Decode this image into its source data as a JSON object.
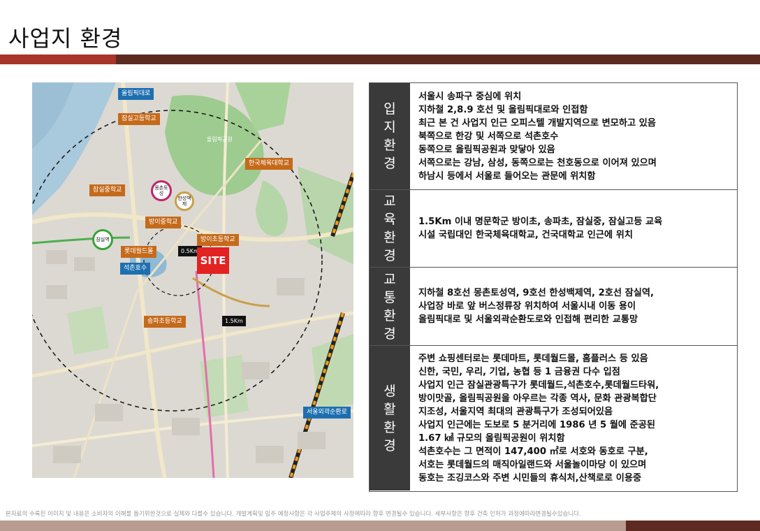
{
  "page": {
    "title": "사업지 환경",
    "footer_note": "본자료의 수록된 이미지 및 내용은 소비자의 이해를 돕기위한것으로 실제와 다를수 있습니다. 개발계획및 입주 예정사항은 각 사업주체의 사정에따라 향후 변경될수 있습니다. 세부사항은 향후 건축 인허가 과정에따라변경될수있습니다."
  },
  "map": {
    "site_label": "SITE",
    "labels": {
      "olympic_road": "올림픽대로",
      "jamsil_high": "잠실고등학교",
      "jamsil_middle": "잠실중학교",
      "korea_sports": "한국체육대학교",
      "bangi_middle": "방이중학교",
      "bangi_elem": "방이초등학교",
      "lotte_world": "롯데월드몰",
      "seokchon_lake": "석촌호수",
      "songpa_elem": "송파초등학교",
      "outer_ring": "서울외곽순환로",
      "r05": "0.5Km",
      "r15": "1.5Km",
      "olympic_park": "올림픽공원",
      "station_jamsil": "잠실역",
      "station_mongchon": "몽촌토성",
      "station_hanseong": "한성백제"
    }
  },
  "table": [
    {
      "header": "입지환경",
      "lines": [
        "서울시 송파구 중심에 위치",
        "지하철 2,8.9 호선 및 올림픽대로와 인접함",
        "최근 본 건 사업지 인근 오피스텔 개발지역으로 변모하고 있음",
        "북쪽으로 한강 및 서쪽으로 석촌호수",
        "동쪽으로 올림픽공원과 맞닿아 있음",
        "서쪽으로는 강남, 삼성, 동쪽으로는 천호동으로 이어져 있으며",
        "하남시 등에서 서울로 들어오는 관문에 위치함"
      ]
    },
    {
      "header": "교육환경",
      "lines": [
        "1.5Km 이내 명문학군 방이초, 송파초, 잠실중, 잠실고등 교육",
        "시설  국립대인 한국체육대학교, 건국대학교 인근에 위치"
      ]
    },
    {
      "header": "교통환경",
      "lines": [
        "지하철 8호선 몽촌토성역, 9호선 한성백제역, 2호선 잠실역,",
        "사업장 바로 앞 버스정류장 위치하여 서울시내 이동 용이",
        "올림픽대로 및 서울외곽순환도로와 인접해 편리한 교통망"
      ]
    },
    {
      "header": "생활환경",
      "lines": [
        "주변 쇼핑센터로는 롯데마트, 롯데월드몰, 홈플러스 등 있음",
        "신한, 국민, 우리, 기업, 농협 등 1 금융권 다수 입점",
        "사업지 인근 잠실관광특구가 롯데월드,석촌호수,롯데월드타워,",
        "방이맛골, 올림픽공원을 아우르는 각종 역사, 문화 관광복합단",
        "지조성, 서울지역 최대의 관광특구가 조성되어있음",
        "사업지 인근에는 도보로 5 분거리에 1986 년 5 월에 준공된",
        "1.67 ㎢ 규모의 올림픽공원이 위치함",
        "석촌호수는 그 면적이 147,400 ㎡로 서호와 동호로 구분,",
        "서호는 롯데월드의 매직아일랜드와 서울놀이마당 이 있으며",
        "동호는 조깅코스와 주변 시민들의 휴식처,산책로로 이용중"
      ]
    }
  ],
  "colors": {
    "accent_red": "#a7352a",
    "accent_brown": "#5c2a20",
    "header_gray": "#3a3a3a",
    "label_orange": "#c56a1b",
    "label_blue": "#1e6fb0",
    "site_red": "#e32222"
  }
}
